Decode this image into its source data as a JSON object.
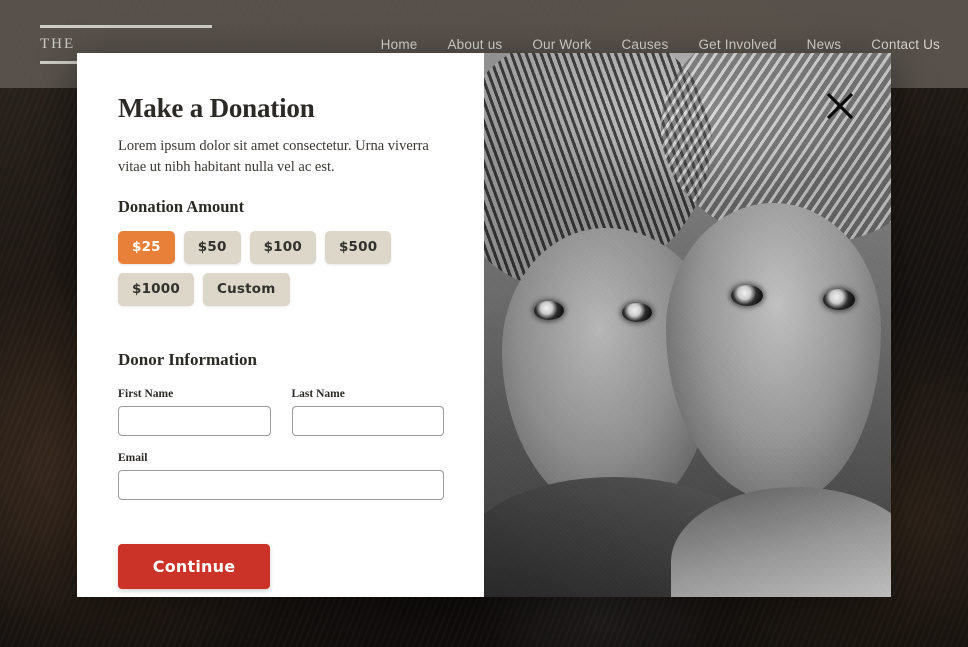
{
  "site": {
    "brand": {
      "name": "THE",
      "rule_icon": "horizontal-rule"
    },
    "nav": [
      {
        "label": "Home"
      },
      {
        "label": "About us"
      },
      {
        "label": "Our Work"
      },
      {
        "label": "Causes"
      },
      {
        "label": "Get Involved"
      },
      {
        "label": "News"
      },
      {
        "label": "Contact Us"
      }
    ]
  },
  "modal": {
    "title": "Make a Donation",
    "description": "Lorem ipsum dolor sit amet consectetur. Urna viverra vitae ut nibh habitant nulla vel ac est.",
    "close_icon": "close-icon",
    "amount_section": {
      "heading": "Donation Amount",
      "selected": "$25",
      "options": [
        {
          "label": "$25",
          "selected": true
        },
        {
          "label": "$50",
          "selected": false
        },
        {
          "label": "$100",
          "selected": false
        },
        {
          "label": "$500",
          "selected": false
        },
        {
          "label": "$1000",
          "selected": false
        },
        {
          "label": "Custom",
          "selected": false
        }
      ]
    },
    "donor_section": {
      "heading": "Donor Information",
      "fields": {
        "first_name": {
          "label": "First Name",
          "value": "",
          "placeholder": ""
        },
        "last_name": {
          "label": "Last Name",
          "value": "",
          "placeholder": ""
        },
        "email": {
          "label": "Email",
          "value": "",
          "placeholder": ""
        }
      }
    },
    "submit_label": "Continue",
    "photo_alt": "two-children-portrait"
  },
  "colors": {
    "accent_orange": "#e8803a",
    "chip_beige": "#ddd7ca",
    "submit_red": "#cc3328",
    "header_gray": "#5c564f",
    "text_dark": "#2c2a27"
  }
}
